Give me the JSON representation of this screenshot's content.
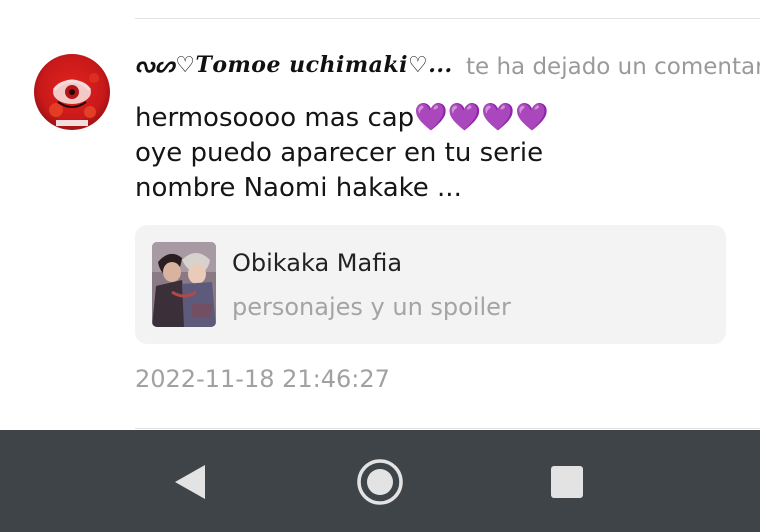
{
  "comment": {
    "username": "ᔓᔕ♡𝑻𝒐𝒎𝒐𝒆 𝒖𝒄𝒉𝒊𝒎𝒂𝒌𝒊♡...",
    "action_text": "te ha dejado un comentari",
    "body_line1": "hermosoooo mas cap",
    "hearts": "💜💜💜💜",
    "body_line2": "oye puedo aparecer en tu serie",
    "body_line3": "nombre Naomi hakake ...",
    "timestamp": "2022-11-18 21:46:27"
  },
  "linked_story": {
    "title": "Obikaka Mafia",
    "subtitle": "personajes y un spoiler"
  },
  "icons": {
    "avatar": "user-avatar-icon",
    "chevron": "chevron-right-icon",
    "back": "back-triangle-icon",
    "home": "home-circle-icon",
    "recents": "recents-square-icon"
  },
  "colors": {
    "heart": "#8a1fd6",
    "navbar": "#3f4449",
    "card_bg": "#f3f3f4",
    "muted_text": "#a1a1a1"
  }
}
